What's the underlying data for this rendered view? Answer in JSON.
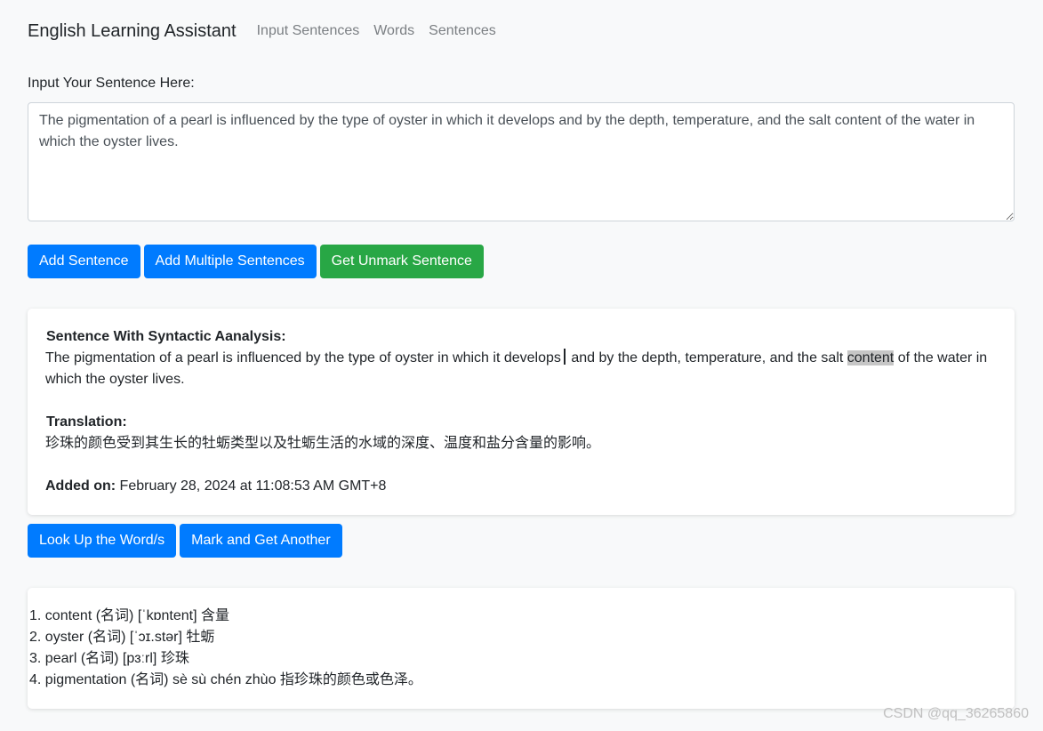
{
  "navbar": {
    "brand": "English Learning Assistant",
    "links": [
      "Input Sentences",
      "Words",
      "Sentences"
    ]
  },
  "input": {
    "label": "Input Your Sentence Here:",
    "value": "The pigmentation of a pearl is influenced by the type of oyster in which it develops and by the depth, temperature, and the salt content of the water in which the oyster lives."
  },
  "buttons": {
    "add_sentence": "Add Sentence",
    "add_multiple": "Add Multiple Sentences",
    "get_unmark": "Get Unmark Sentence",
    "look_up": "Look Up the Word/s",
    "mark_and_get": "Mark and Get Another"
  },
  "analysis": {
    "title": "Sentence With Syntactic Aanalysis:",
    "sentence_part1": "The pigmentation of a pearl is influenced by the type of oyster in which it develops",
    "sentence_part2": " and by the depth, temperature, and the salt ",
    "highlighted_word": "content",
    "sentence_part3": " of the water in which the oyster lives.",
    "translation_title": "Translation:",
    "translation": "珍珠的颜色受到其生长的牡蛎类型以及牡蛎生活的水域的深度、温度和盐分含量的影响。",
    "added_label": "Added on:",
    "added_value": " February 28, 2024 at 11:08:53 AM GMT+8"
  },
  "words": [
    "1. content (名词) [ˈkɒntent] 含量",
    "2. oyster (名词) [ˈɔɪ.stər] 牡蛎",
    "3. pearl (名词) [pɜːrl] 珍珠",
    "4. pigmentation (名词) sè sù chén zhùo 指珍珠的颜色或色泽。"
  ],
  "watermark": "CSDN @qq_36265860",
  "colors": {
    "primary": "#007bff",
    "success": "#28a745",
    "highlight": "#c6c6c6",
    "background": "#f8f9fa"
  }
}
